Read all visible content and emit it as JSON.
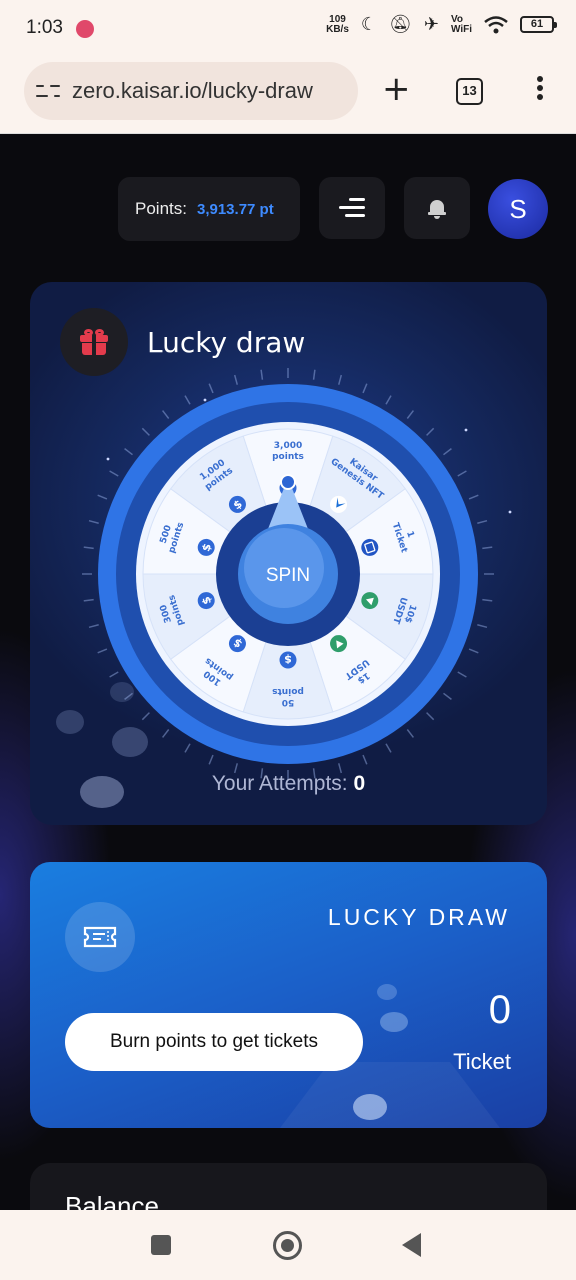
{
  "status_bar": {
    "time": "1:03",
    "net_speed_value": "109",
    "net_speed_unit": "KB/s",
    "wifi_label_1": "Vo",
    "wifi_label_2": "WiFi",
    "battery": "61"
  },
  "browser": {
    "url": "zero.kaisar.io/lucky-draw",
    "tab_count": "13"
  },
  "header": {
    "points_label": "Points:",
    "points_value": "3,913.77 pt",
    "avatar_initial": "S"
  },
  "lucky_draw": {
    "title": "Lucky draw",
    "spin_label": "SPIN",
    "attempts_label": "Your Attempts:",
    "attempts_value": "0",
    "segments": [
      {
        "line1": "3,000",
        "line2": "points",
        "icon": "dollar-coin-icon"
      },
      {
        "line1": "Kaisar",
        "line2": "Genesis NFT",
        "icon": "kaisar-logo-icon"
      },
      {
        "line1": "1",
        "line2": "Ticket",
        "icon": "ticket-icon"
      },
      {
        "line1": "10$",
        "line2": "USDT",
        "icon": "usdt-icon"
      },
      {
        "line1": "1$",
        "line2": "USDT",
        "icon": "usdt-icon"
      },
      {
        "line1": "50",
        "line2": "points",
        "icon": "dollar-coin-icon"
      },
      {
        "line1": "100",
        "line2": "points",
        "icon": "dollar-coin-icon"
      },
      {
        "line1": "300",
        "line2": "points",
        "icon": "dollar-coin-icon"
      },
      {
        "line1": "500",
        "line2": "points",
        "icon": "dollar-coin-icon"
      },
      {
        "line1": "1,000",
        "line2": "points",
        "icon": "dollar-coin-icon"
      }
    ]
  },
  "ticket_card": {
    "title": "LUCKY DRAW",
    "burn_button": "Burn points to get tickets",
    "ticket_count": "0",
    "ticket_unit": "Ticket"
  },
  "balance_card": {
    "title": "Balance"
  },
  "colors": {
    "accent_blue": "#3e8bff",
    "gift_red": "#e33b4c",
    "wheel_blue": "#2f74e6"
  }
}
